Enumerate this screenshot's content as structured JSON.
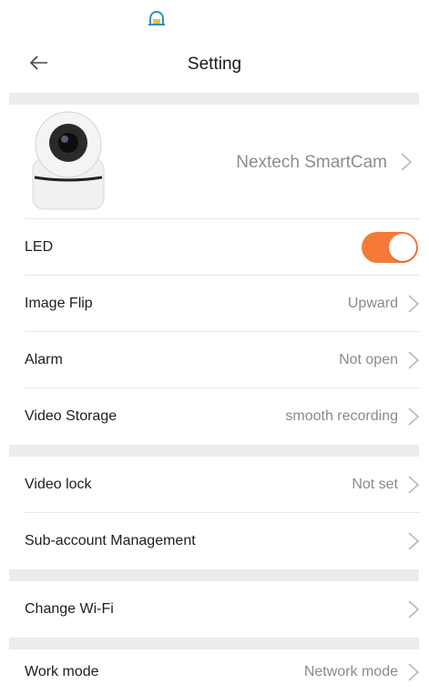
{
  "header": {
    "title": "Setting"
  },
  "device": {
    "name": "Nextech SmartCam"
  },
  "settings": {
    "led": {
      "label": "LED",
      "enabled": true
    },
    "image_flip": {
      "label": "Image Flip",
      "value": "Upward"
    },
    "alarm": {
      "label": "Alarm",
      "value": "Not open"
    },
    "video_storage": {
      "label": "Video Storage",
      "value": "smooth recording"
    },
    "video_lock": {
      "label": "Video lock",
      "value": "Not set"
    },
    "sub_account": {
      "label": "Sub-account Management"
    },
    "change_wifi": {
      "label": "Change Wi-Fi"
    },
    "work_mode": {
      "label": "Work mode",
      "value": "Network mode"
    }
  },
  "icons": {
    "status": "notification-bell-icon",
    "back": "back-arrow-icon",
    "chevron": "chevron-right-icon",
    "camera": "camera-device-icon"
  },
  "colors": {
    "accent": "#f57a3a",
    "status_icon": "#2f8fbf",
    "separator": "#ececec"
  }
}
